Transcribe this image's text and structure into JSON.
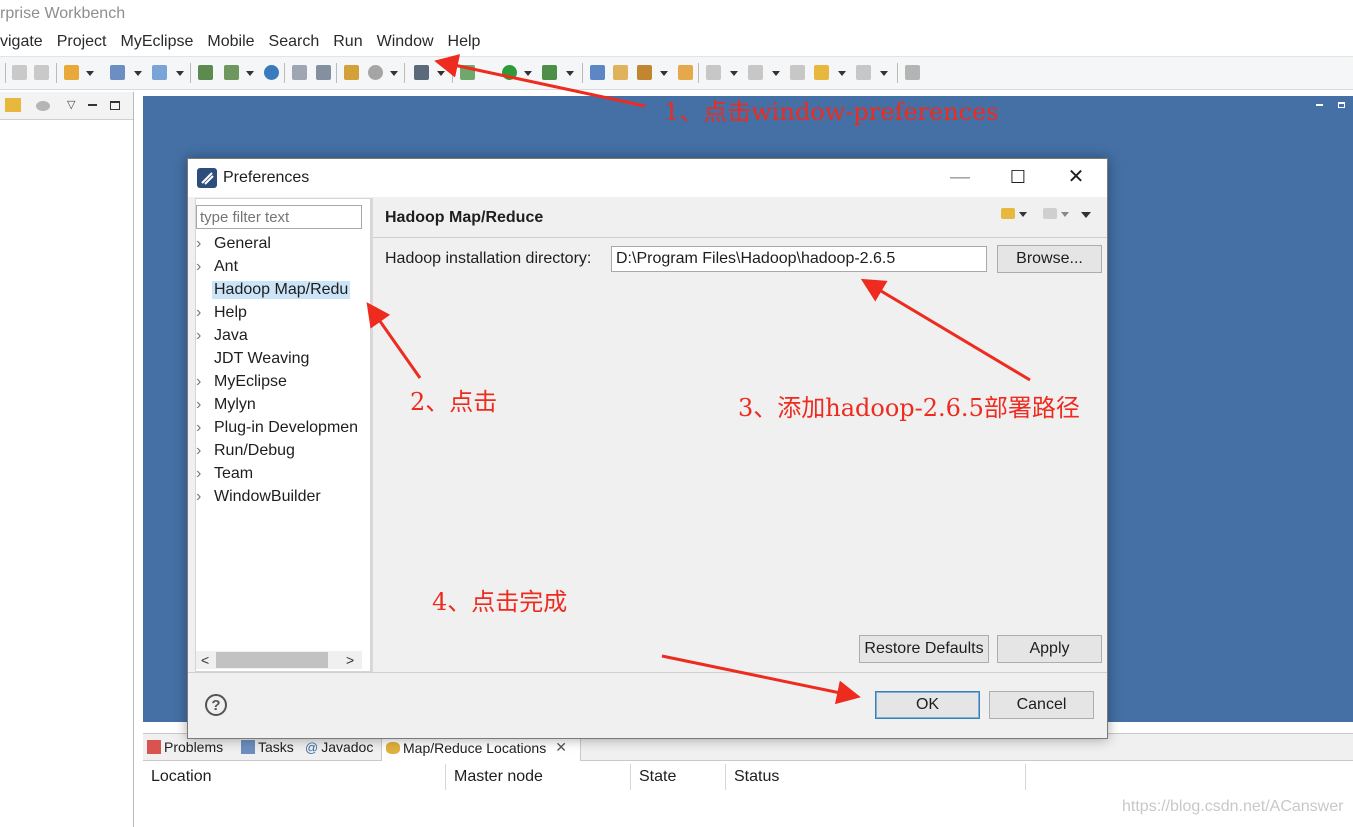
{
  "window": {
    "title": "rprise Workbench"
  },
  "menu": [
    "vigate",
    "Project",
    "MyEclipse",
    "Mobile",
    "Search",
    "Run",
    "Window",
    "Help"
  ],
  "dialog": {
    "title": "Preferences",
    "filter_placeholder": "type filter text",
    "tree": [
      "General",
      "Ant",
      "Hadoop Map/Redu",
      "Help",
      "Java",
      "JDT Weaving",
      "MyEclipse",
      "Mylyn",
      "Plug-in Developmen",
      "Run/Debug",
      "Team",
      "WindowBuilder"
    ],
    "tree_expandable": [
      true,
      true,
      false,
      true,
      true,
      false,
      true,
      true,
      true,
      true,
      true,
      true
    ],
    "selected_index": 2,
    "page_title": "Hadoop Map/Reduce",
    "dir_label": "Hadoop installation directory:",
    "dir_value": "D:\\Program Files\\Hadoop\\hadoop-2.6.5",
    "browse_label": "Browse...",
    "restore_label": "Restore Defaults",
    "apply_label": "Apply",
    "ok_label": "OK",
    "cancel_label": "Cancel",
    "help_icon": "?"
  },
  "bottom_panel": {
    "tabs": [
      {
        "label": "Problems",
        "icon": "problems-icon"
      },
      {
        "label": "Tasks",
        "icon": "tasks-icon"
      },
      {
        "label": "Javadoc",
        "icon": "javadoc-icon"
      },
      {
        "label": "Map/Reduce Locations",
        "icon": "elephant-icon"
      }
    ],
    "active_tab": 3,
    "columns": [
      "Location",
      "Master node",
      "State",
      "Status"
    ]
  },
  "annotations": {
    "step1": "1、点击window-preferences",
    "step2": "2、点击",
    "step3": "3、添加hadoop-2.6.5部署路径",
    "step4": "4、点击完成"
  },
  "watermark": "https://blog.csdn.net/ACanswer",
  "colors": {
    "editor_bg": "#4470a5",
    "annotation": "#ee2b1f",
    "selection": "#cce4f7"
  }
}
